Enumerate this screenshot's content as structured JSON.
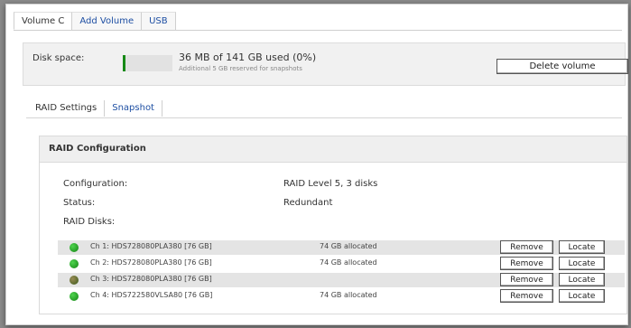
{
  "top_tabs": [
    {
      "label": "Volume C"
    },
    {
      "label": "Add Volume"
    },
    {
      "label": "USB"
    }
  ],
  "disk_space": {
    "label": "Disk space:",
    "used_text": "36 MB of 141 GB used (0%)",
    "reserved_text": "Additional 5 GB reserved for snapshots",
    "usage_percent": 0
  },
  "delete_button": "Delete volume",
  "sub_tabs": [
    {
      "label": "RAID Settings"
    },
    {
      "label": "Snapshot"
    }
  ],
  "raid": {
    "title": "RAID Configuration",
    "configuration_label": "Configuration:",
    "configuration_value": "RAID Level 5, 3 disks",
    "status_label": "Status:",
    "status_value": "Redundant",
    "disks_label": "RAID Disks:",
    "disks": [
      {
        "name": "Ch 1: HDS728080PLA380 [76 GB]",
        "allocated": "74 GB allocated",
        "status": "ok"
      },
      {
        "name": "Ch 2: HDS728080PLA380 [76 GB]",
        "allocated": "74 GB allocated",
        "status": "ok"
      },
      {
        "name": "Ch 3: HDS728080PLA380 [76 GB]",
        "allocated": "",
        "status": "warn"
      },
      {
        "name": "Ch 4: HDS722580VLSA80 [76 GB]",
        "allocated": "74 GB allocated",
        "status": "ok"
      }
    ],
    "remove_label": "Remove",
    "locate_label": "Locate"
  },
  "colors": {
    "link": "#1e4fa3",
    "status_ok": "#178a17",
    "status_warn": "#6b5a2a"
  }
}
